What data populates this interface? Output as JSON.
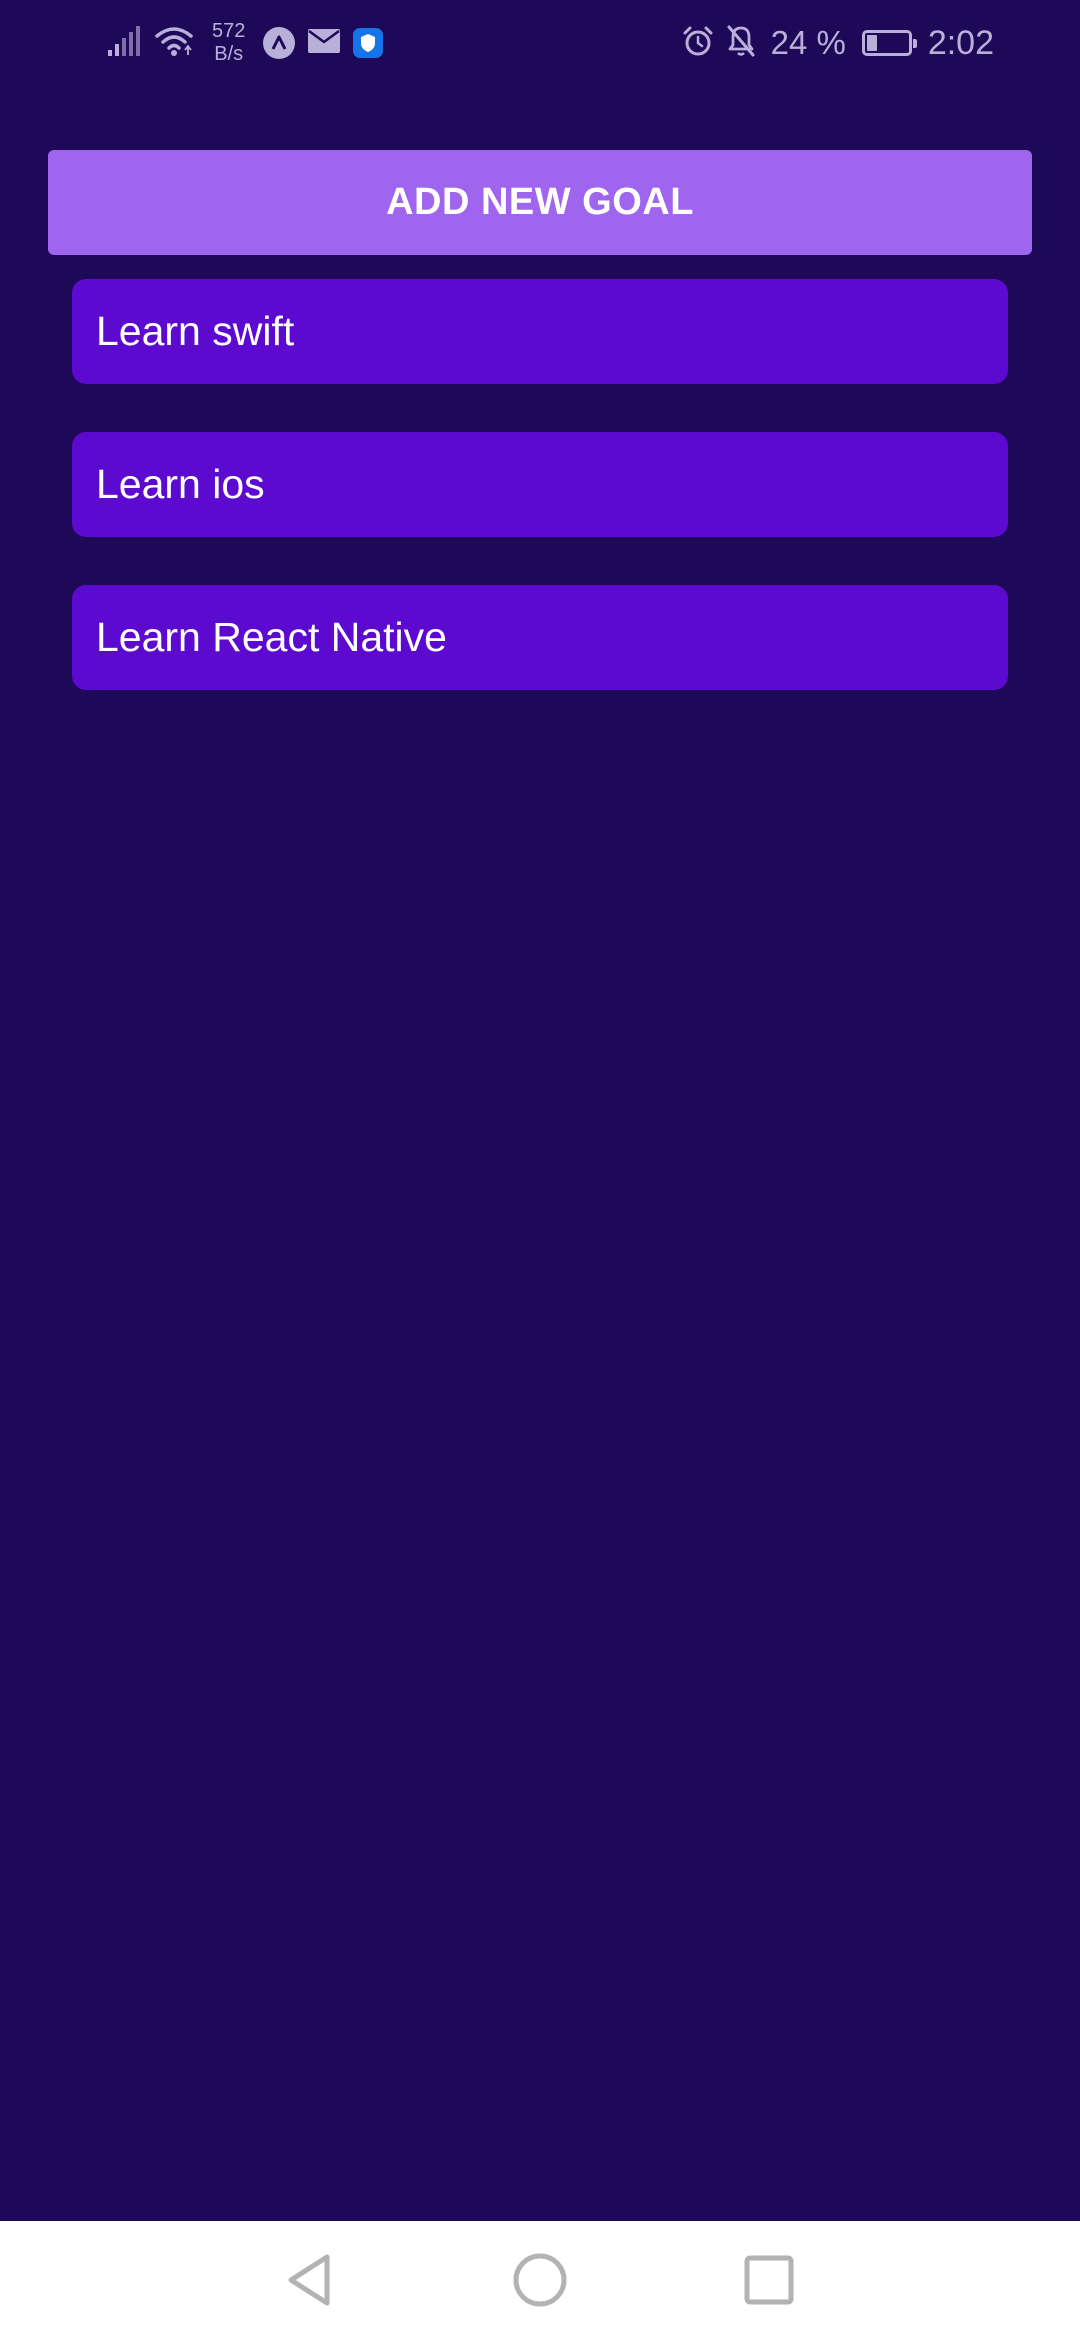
{
  "status_bar": {
    "net_speed_value": "572",
    "net_speed_unit": "B/s",
    "battery_percent": "24 %",
    "battery_level": 0.24,
    "time": "2:02",
    "icons": [
      "signal-icon",
      "wifi-icon",
      "app-a-icon",
      "mail-icon",
      "shield-icon",
      "alarm-icon",
      "bell-off-icon",
      "battery-icon"
    ]
  },
  "main": {
    "add_button_label": "ADD NEW GOAL",
    "goals": [
      {
        "label": "Learn swift"
      },
      {
        "label": "Learn ios"
      },
      {
        "label": "Learn React Native"
      }
    ]
  },
  "nav_bar": {
    "icons": [
      "back-icon",
      "home-icon",
      "recents-icon"
    ]
  },
  "colors": {
    "background": "#1e0858",
    "add_button": "#a065ef",
    "goal_item": "#5c0acf",
    "status_text": "#b9b0d9",
    "nav_bar": "#ffffff",
    "nav_icon": "#b3b3b3"
  }
}
